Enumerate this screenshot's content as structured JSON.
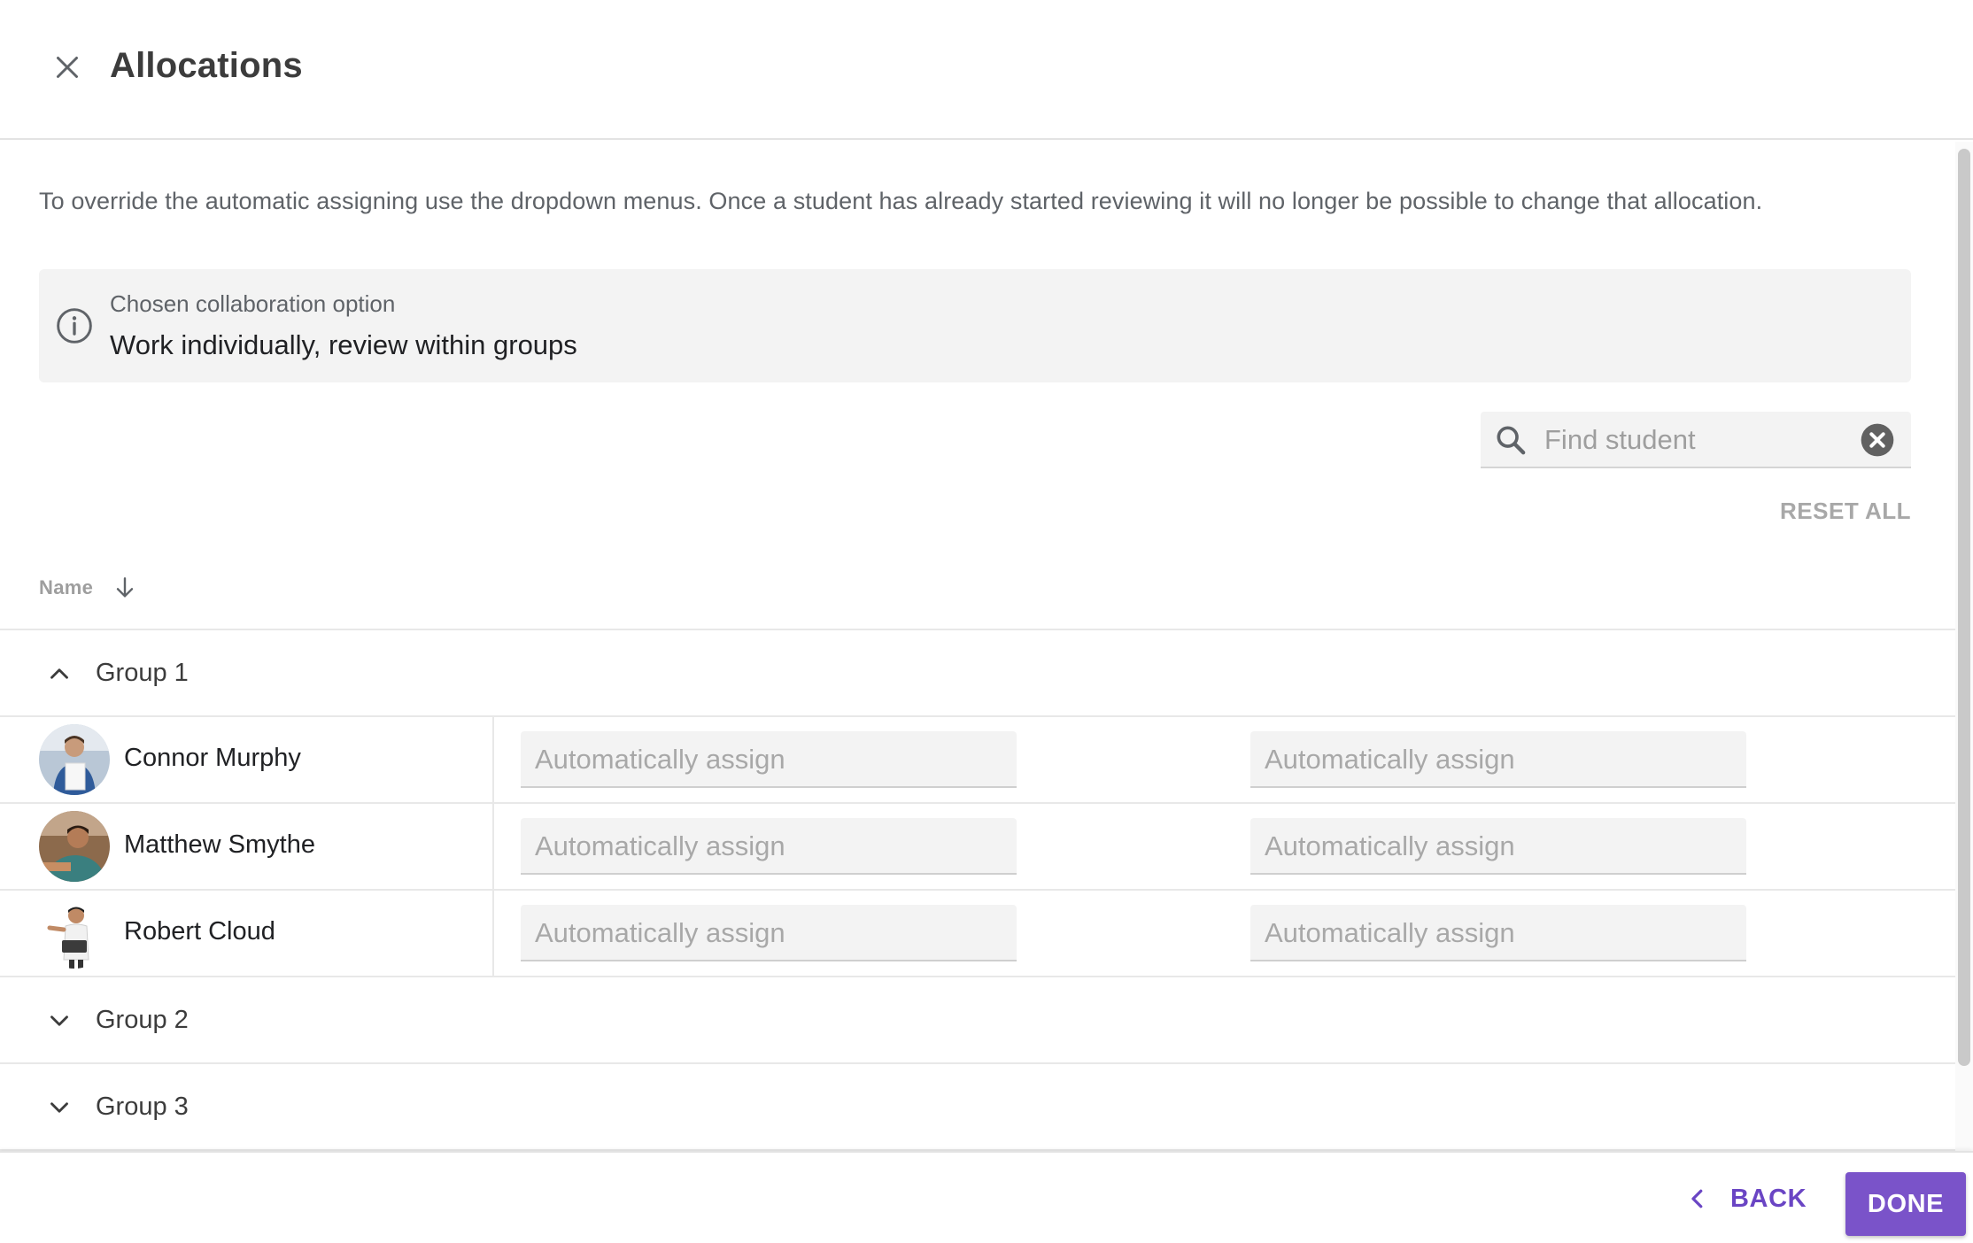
{
  "header": {
    "title": "Allocations",
    "close_icon": "close-icon"
  },
  "intro": "To override the automatic assigning use the dropdown menus. Once a student has already started reviewing it will no longer be possible to change that allocation.",
  "info": {
    "icon": "info-icon",
    "label": "Chosen collaboration option",
    "value": "Work individually, review within groups"
  },
  "search": {
    "placeholder": "Find student",
    "value": ""
  },
  "reset_all_label": "RESET ALL",
  "sort": {
    "label": "Name",
    "direction": "descending"
  },
  "groups": [
    {
      "label": "Group 1",
      "expanded": true,
      "students": [
        {
          "name": "Connor Murphy",
          "avatar_color": "#5b7fa6",
          "review_1": "Automatically assign",
          "review_2": "Automatically assign"
        },
        {
          "name": "Matthew Smythe",
          "avatar_color": "#7a5a3f",
          "review_1": "Automatically assign",
          "review_2": "Automatically assign"
        },
        {
          "name": "Robert Cloud",
          "avatar_color": "#e9e9e9",
          "review_1": "Automatically assign",
          "review_2": "Automatically assign"
        }
      ]
    },
    {
      "label": "Group 2",
      "expanded": false,
      "students": []
    },
    {
      "label": "Group 3",
      "expanded": false,
      "students": []
    }
  ],
  "footer": {
    "back_label": "BACK",
    "done_label": "DONE"
  },
  "colors": {
    "accent": "#7a53c9",
    "accent_text": "#6a45c4",
    "muted": "#a8a8a8",
    "panel": "#f3f3f3"
  }
}
